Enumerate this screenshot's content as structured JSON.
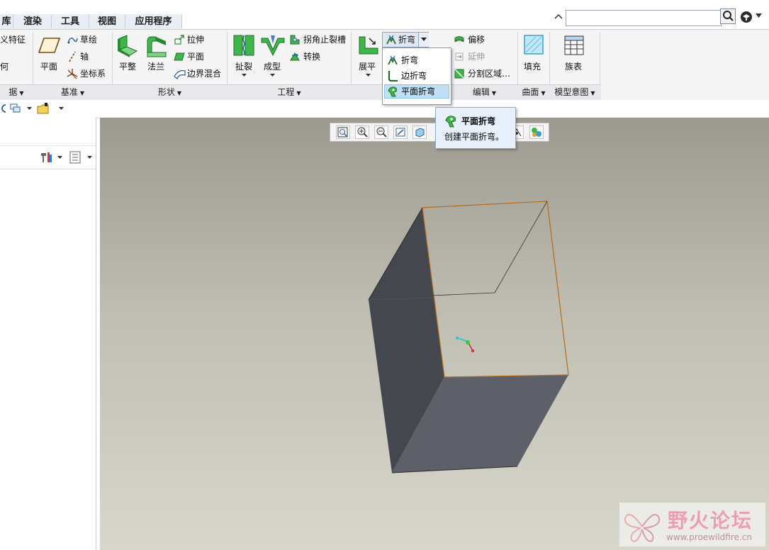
{
  "menu_tabs": [
    "库",
    "渲染",
    "工具",
    "视图",
    "应用程序"
  ],
  "search": {
    "value": ""
  },
  "ribbon": {
    "datum_left": {
      "item1": "义特征",
      "item2": "何",
      "group": "据"
    },
    "datum": {
      "plane": "平面",
      "sketch": "草绘",
      "axis": "轴",
      "csys": "坐标系",
      "group": "基准"
    },
    "shapes": {
      "flat": "平整",
      "flange": "法兰",
      "extrude": "拉伸",
      "planar": "平面",
      "blend": "边界混合",
      "group": "形状"
    },
    "engineering": {
      "rip": "扯裂",
      "form": "成型",
      "corner_relief": "拐角止裂槽",
      "convert": "转换",
      "group": "工程"
    },
    "bends": {
      "unbend": "展平",
      "bend": "折弯"
    },
    "editing": {
      "offset": "偏移",
      "extend": "延伸",
      "split": "分割区域…",
      "group": "编辑"
    },
    "surfaces": {
      "fill": "填充",
      "group": "曲面"
    },
    "model_intent": {
      "family": "族表",
      "group": "模型意图"
    }
  },
  "bend_menu": {
    "items": [
      "折弯",
      "边折弯",
      "平面折弯"
    ],
    "highlighted": "平面折弯"
  },
  "tooltip": {
    "title": "平面折弯",
    "description": "创建平面折弯。"
  },
  "watermark": {
    "title": "野火论坛",
    "url": "www.proewildfire.cn"
  },
  "colors": {
    "accent": "#1f7fc4",
    "highlight": "#bfe0f7",
    "part_face": "#4b4e56",
    "edge": "#b36b1e"
  }
}
